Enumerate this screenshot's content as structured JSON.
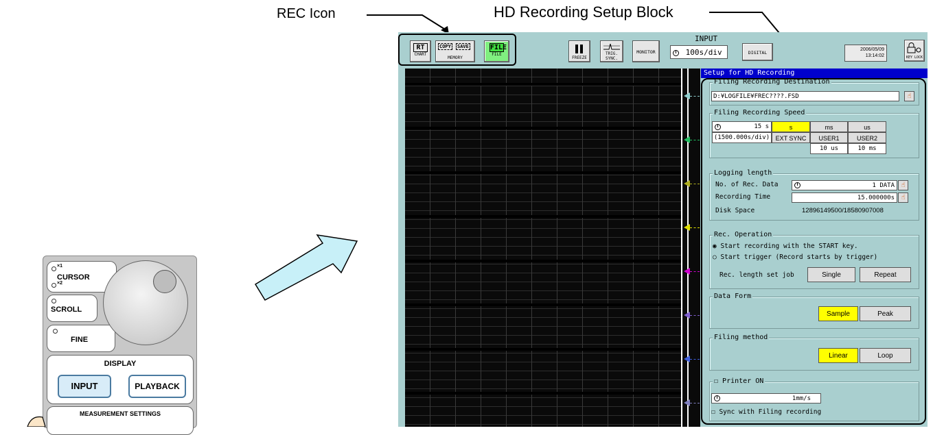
{
  "callouts": {
    "rec_icon": "REC Icon",
    "hd_setup_block": "HD Recording Setup Block"
  },
  "toolbar": {
    "rt": {
      "top": "RT",
      "bottom": "CHART"
    },
    "copy": "COPY",
    "save": "SAVE",
    "memory": "MEMORY",
    "file": {
      "top": "FILE",
      "bottom": "FILE"
    },
    "freeze": "FREEZE",
    "trig_sync": {
      "top": "TRIG.",
      "bottom": "SYNC."
    },
    "monitor": "MONITOR",
    "input_label": "INPUT",
    "timebase": "100s/div",
    "digital": "DIGITAL",
    "date": "2006/05/09",
    "time": "13:14:02",
    "key_lock": "KEY LOCK"
  },
  "setup": {
    "title": "Setup for HD Recording",
    "destination": {
      "label": "Filing Recording Destination",
      "path": "D:¥LOGFILE¥FREC????.FSD"
    },
    "speed": {
      "label": "Filing Recording Speed",
      "value": "15 s",
      "per_div": "(1500.000s/div)",
      "units": [
        "s",
        "ms",
        "us"
      ],
      "selected_unit": "s",
      "ext_sync": "EXT SYNC",
      "user1": "USER1",
      "user2": "USER2",
      "user1_val": "10 us",
      "user2_val": "10 ms"
    },
    "logging": {
      "label": "Logging length",
      "rec_data_label": "No. of Rec. Data",
      "rec_data_value": "1 DATA",
      "rec_time_label": "Recording Time",
      "rec_time_value": "15.000000s",
      "disk_label": "Disk Space",
      "disk_value": "12896149500/18580907008"
    },
    "operation": {
      "label": "Rec. Operation",
      "opt1": "Start recording with the START key.",
      "opt2": "Start trigger (Record starts by trigger)",
      "job_label": "Rec. length set job",
      "single": "Single",
      "repeat": "Repeat"
    },
    "data_form": {
      "label": "Data Form",
      "sample": "Sample",
      "peak": "Peak"
    },
    "filing_method": {
      "label": "Filing method",
      "linear": "Linear",
      "loop": "Loop"
    },
    "printer": {
      "label": "Printer ON",
      "speed": "1mm/s",
      "sync": "Sync with Filing recording"
    }
  },
  "channel_colors": [
    "#8fcfcf",
    "#20c060",
    "#b0b020",
    "#e0e000",
    "#d000d0",
    "#8060d0",
    "#4060e0",
    "#8080c0"
  ],
  "panel": {
    "x1": "×1",
    "x2": "×2",
    "cursor": "CURSOR",
    "scroll": "SCROLL",
    "fine": "FINE",
    "display": "DISPLAY",
    "input": "INPUT",
    "playback": "PLAYBACK",
    "measurement": "MEASUREMENT SETTINGS"
  }
}
